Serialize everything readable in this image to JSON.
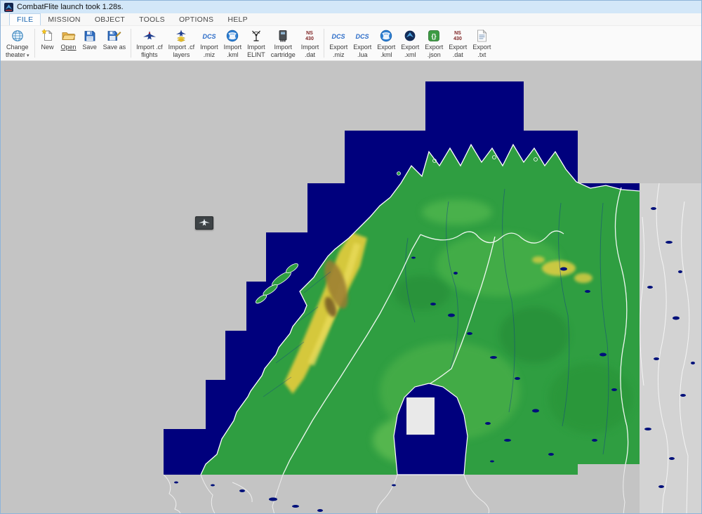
{
  "window": {
    "title": "CombatFlite launch took 1.28s."
  },
  "menu": {
    "items": [
      {
        "label": "FILE",
        "active": true
      },
      {
        "label": "MISSION",
        "active": false
      },
      {
        "label": "OBJECT",
        "active": false
      },
      {
        "label": "TOOLS",
        "active": false
      },
      {
        "label": "OPTIONS",
        "active": false
      },
      {
        "label": "HELP",
        "active": false
      }
    ]
  },
  "toolbar": {
    "caret": "▾",
    "buttons": [
      {
        "line1": "Change",
        "line2": "theater",
        "icon": "globe-icon"
      },
      {
        "line1": "New",
        "line2": "",
        "icon": "new-document-icon"
      },
      {
        "line1": "Open",
        "line2": "",
        "icon": "open-folder-icon"
      },
      {
        "line1": "Save",
        "line2": "",
        "icon": "save-floppy-icon"
      },
      {
        "line1": "Save as",
        "line2": "",
        "icon": "save-as-floppy-icon"
      },
      {
        "line1": "Import .cf",
        "line2": "flights",
        "icon": "jet-icon"
      },
      {
        "line1": "Import .cf",
        "line2": "layers",
        "icon": "jet-layers-icon"
      },
      {
        "line1": "Import",
        "line2": ".miz",
        "icon": "dcs-logo-icon"
      },
      {
        "line1": "Import",
        "line2": ".kml",
        "icon": "google-earth-globe-icon"
      },
      {
        "line1": "Import",
        "line2": "ELINT",
        "icon": "antenna-icon"
      },
      {
        "line1": "Import",
        "line2": "cartridge",
        "icon": "cartridge-icon"
      },
      {
        "line1": "Import",
        "line2": ".dat",
        "icon": "ns430-icon"
      },
      {
        "line1": "Export",
        "line2": ".miz",
        "icon": "dcs-logo-icon"
      },
      {
        "line1": "Export",
        "line2": ".lua",
        "icon": "dcs-logo-icon"
      },
      {
        "line1": "Export",
        "line2": ".kml",
        "icon": "google-earth-globe-icon"
      },
      {
        "line1": "Export",
        "line2": ".xml",
        "icon": "combatflite-logo-icon"
      },
      {
        "line1": "Export",
        "line2": ".json",
        "icon": "json-icon"
      },
      {
        "line1": "Export",
        "line2": ".dat",
        "icon": "ns430-icon"
      },
      {
        "line1": "Export",
        "line2": ".txt",
        "icon": "text-file-icon"
      }
    ]
  },
  "icons": {
    "dcs_label": "DCS",
    "ns430_line1": "NS",
    "ns430_line2": "430",
    "json_glyph": "{}"
  },
  "map": {
    "background_color": "#c4c4c4",
    "lowres_color": "#d3d3d3",
    "sea_color": "#00007d",
    "land_color": "#2f9e41",
    "highland_color": "#dfcb3e",
    "border_color": "#ffffff",
    "marker": {
      "kind": "aircraft"
    }
  }
}
